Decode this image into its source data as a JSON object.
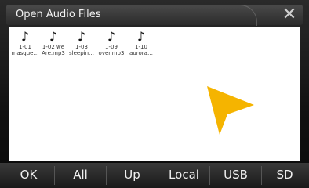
{
  "title": "Open Audio Files",
  "close_symbol": "✕",
  "files": [
    {
      "line1": "1-01",
      "line2": "masque…"
    },
    {
      "line1": "1-02 we",
      "line2": "Are.mp3"
    },
    {
      "line1": "1-03",
      "line2": "sleepin…"
    },
    {
      "line1": "1-09",
      "line2": "over.mp3"
    },
    {
      "line1": "1-10",
      "line2": "aurora…"
    }
  ],
  "buttons": {
    "ok": "OK",
    "all": "All",
    "up": "Up",
    "local": "Local",
    "usb": "USB",
    "sd": "SD"
  },
  "colors": {
    "cursor": "#f5b400",
    "file_area": "#ffffff"
  },
  "icons": {
    "file": "music-note-icon",
    "close": "close-icon"
  }
}
